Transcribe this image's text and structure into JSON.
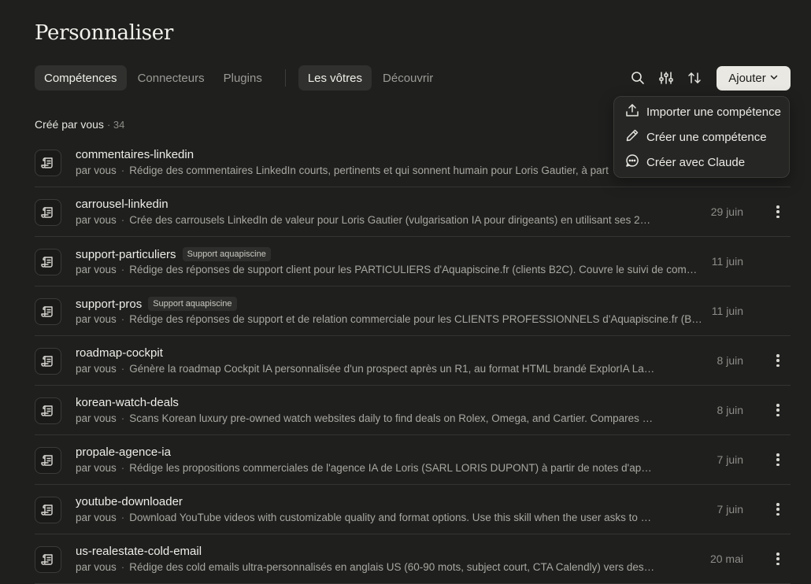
{
  "page": {
    "title": "Personnaliser"
  },
  "tabs": {
    "primary": [
      {
        "label": "Compétences",
        "active": true
      },
      {
        "label": "Connecteurs",
        "active": false
      },
      {
        "label": "Plugins",
        "active": false
      }
    ],
    "secondary": [
      {
        "label": "Les vôtres",
        "active": true
      },
      {
        "label": "Découvrir",
        "active": false
      }
    ]
  },
  "toolbar": {
    "icons": [
      "search-icon",
      "filter-sliders-icon",
      "sort-arrows-icon"
    ],
    "add_label": "Ajouter"
  },
  "dropdown": {
    "items": [
      {
        "label": "Importer une compétence",
        "icon": "upload-icon"
      },
      {
        "label": "Créer une compétence",
        "icon": "pencil-icon"
      },
      {
        "label": "Créer avec Claude",
        "icon": "chat-bubble-icon"
      }
    ]
  },
  "section": {
    "label": "Créé par vous",
    "count": "· 34"
  },
  "skills": [
    {
      "name": "commentaires-linkedin",
      "badge": "",
      "author": "par vous",
      "sep": "·",
      "description": "Rédige des commentaires LinkedIn courts, pertinents et qui sonnent humain pour Loris Gautier, à part",
      "date": "",
      "menu": false
    },
    {
      "name": "carrousel-linkedin",
      "badge": "",
      "author": "par vous",
      "sep": "·",
      "description": "Crée des carrousels LinkedIn de valeur pour Loris Gautier (vulgarisation IA pour dirigeants) en utilisant ses 2…",
      "date": "29 juin",
      "menu": true
    },
    {
      "name": "support-particuliers",
      "badge": "Support aquapiscine",
      "author": "par vous",
      "sep": "·",
      "description": "Rédige des réponses de support client pour les PARTICULIERS d'Aquapiscine.fr (clients B2C). Couvre le suivi de comm…",
      "date": "11 juin",
      "menu": false
    },
    {
      "name": "support-pros",
      "badge": "Support aquapiscine",
      "author": "par vous",
      "sep": "·",
      "description": "Rédige des réponses de support et de relation commerciale pour les CLIENTS PROFESSIONNELS d'Aquapiscine.fr (B2…",
      "date": "11 juin",
      "menu": false
    },
    {
      "name": "roadmap-cockpit",
      "badge": "",
      "author": "par vous",
      "sep": "·",
      "description": "Génère la roadmap Cockpit IA personnalisée d'un prospect après un R1, au format HTML brandé ExplorIA La…",
      "date": "8 juin",
      "menu": true
    },
    {
      "name": "korean-watch-deals",
      "badge": "",
      "author": "par vous",
      "sep": "·",
      "description": "Scans Korean luxury pre-owned watch websites daily to find deals on Rolex, Omega, and Cartier. Compares …",
      "date": "8 juin",
      "menu": true
    },
    {
      "name": "propale-agence-ia",
      "badge": "",
      "author": "par vous",
      "sep": "·",
      "description": "Rédige les propositions commerciales de l'agence IA de Loris (SARL LORIS DUPONT) à partir de notes d'app…",
      "date": "7 juin",
      "menu": true
    },
    {
      "name": "youtube-downloader",
      "badge": "",
      "author": "par vous",
      "sep": "·",
      "description": "Download YouTube videos with customizable quality and format options. Use this skill when the user asks to …",
      "date": "7 juin",
      "menu": true
    },
    {
      "name": "us-realestate-cold-email",
      "badge": "",
      "author": "par vous",
      "sep": "·",
      "description": "Rédige des cold emails ultra-personnalisés en anglais US (60-90 mots, subject court, CTA Calendly) vers des …",
      "date": "20 mai",
      "menu": true
    }
  ]
}
